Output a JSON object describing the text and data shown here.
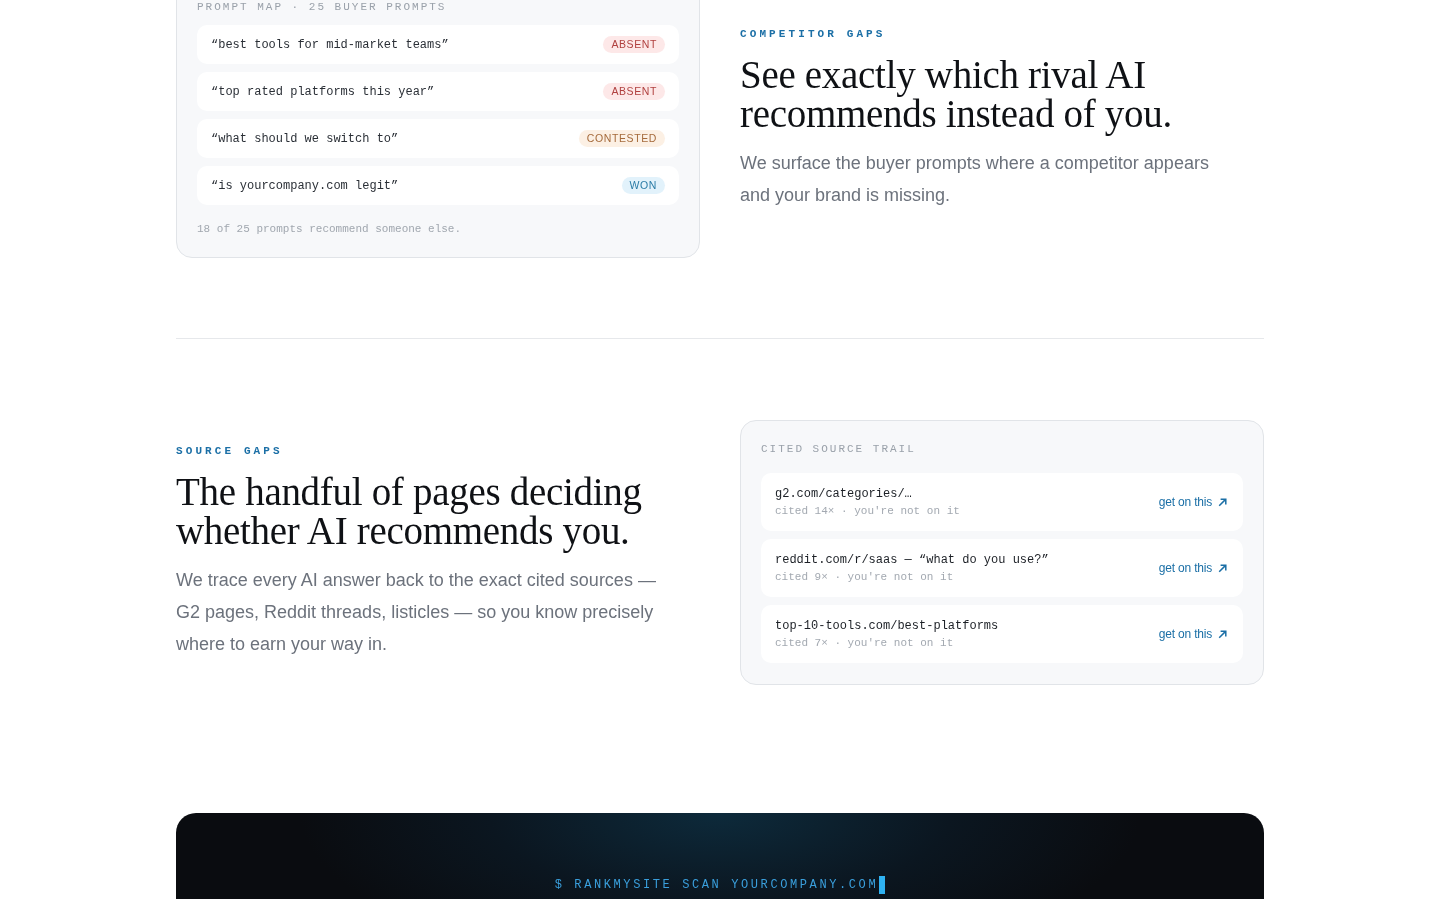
{
  "competitor_gaps": {
    "prompt_map": {
      "label": "PROMPT MAP · 25 BUYER PROMPTS",
      "prompts": [
        {
          "text": "“best tools for mid-market teams”",
          "kind": "absent",
          "badge": "ABSENT"
        },
        {
          "text": "“top rated platforms this year”",
          "kind": "absent",
          "badge": "ABSENT"
        },
        {
          "text": "“what should we switch to”",
          "kind": "contested",
          "badge": "CONTESTED"
        },
        {
          "text": "“is yourcompany.com legit”",
          "kind": "won",
          "badge": "WON"
        }
      ],
      "footer": "18 of 25 prompts recommend someone else."
    },
    "eyebrow": "COMPETITOR GAPS",
    "heading": "See exactly which rival AI recommends instead of you.",
    "body": "We surface the buyer prompts where a competitor appears and your brand is missing."
  },
  "source_gaps": {
    "eyebrow": "SOURCE GAPS",
    "heading": "The handful of pages deciding whether AI recommends you.",
    "body": "We trace every AI answer back to the exact cited sources — G2 pages, Reddit threads, listicles — so you know precisely where to earn your way in.",
    "source_trail": {
      "label": "CITED SOURCE TRAIL",
      "sources": [
        {
          "url": "g2.com/categories/…",
          "meta": "cited 14× · you're not on it",
          "link": "get on this"
        },
        {
          "url": "reddit.com/r/saas — “what do you use?”",
          "meta": "cited 9× · you're not on it",
          "link": "get on this"
        },
        {
          "url": "top-10-tools.com/best-platforms",
          "meta": "cited 7× · you're not on it",
          "link": "get on this"
        }
      ]
    }
  },
  "cta": {
    "command": "$ RANKMYSITE SCAN YOURCOMPANY.COM"
  }
}
